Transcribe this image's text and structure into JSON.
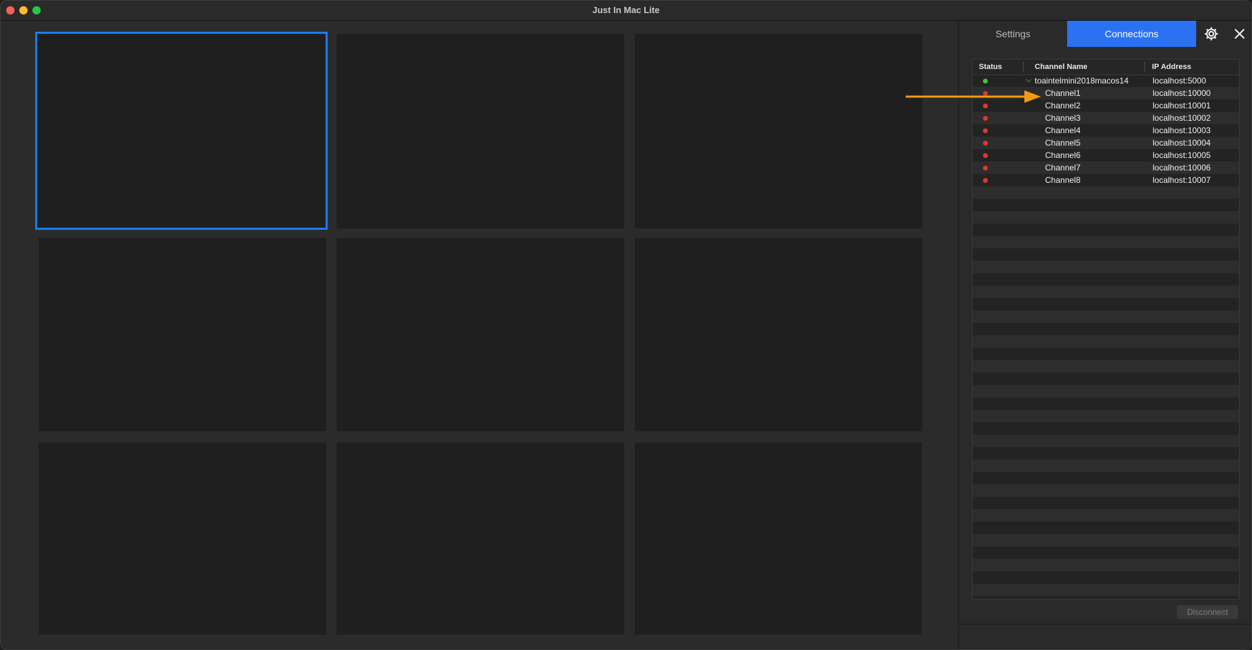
{
  "window": {
    "title": "Just In Mac Lite"
  },
  "panel": {
    "tabs": {
      "settings": "Settings",
      "connections": "Connections"
    },
    "active_tab": "Connections",
    "table": {
      "headers": {
        "status": "Status",
        "channel_name": "Channel Name",
        "ip_address": "IP Address"
      },
      "rows": [
        {
          "status": "connected",
          "name": "toaintelmini2018macos14",
          "ip": "localhost:5000",
          "expanded": true
        },
        {
          "status": "disconnected",
          "name": "Channel1",
          "ip": "localhost:10000"
        },
        {
          "status": "disconnected",
          "name": "Channel2",
          "ip": "localhost:10001"
        },
        {
          "status": "disconnected",
          "name": "Channel3",
          "ip": "localhost:10002"
        },
        {
          "status": "disconnected",
          "name": "Channel4",
          "ip": "localhost:10003"
        },
        {
          "status": "disconnected",
          "name": "Channel5",
          "ip": "localhost:10004"
        },
        {
          "status": "disconnected",
          "name": "Channel6",
          "ip": "localhost:10005"
        },
        {
          "status": "disconnected",
          "name": "Channel7",
          "ip": "localhost:10006"
        },
        {
          "status": "disconnected",
          "name": "Channel8",
          "ip": "localhost:10007"
        }
      ]
    },
    "disconnect_label": "Disconnect"
  },
  "colors": {
    "accent": "#2a72f2",
    "selection": "#1a7cf0",
    "status_connected": "#3ec43e",
    "status_disconnected": "#e0382c",
    "annotation_arrow": "#f59a14"
  },
  "icons": [
    "gear-icon",
    "close-icon",
    "chevron-down-icon",
    "arrow-annotation"
  ]
}
